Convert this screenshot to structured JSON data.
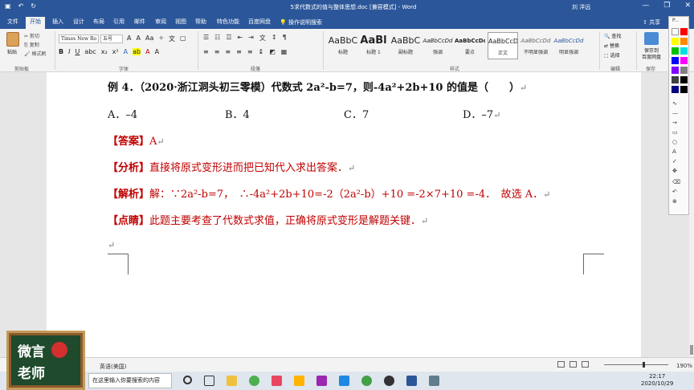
{
  "titlebar": {
    "title": "5求代数式的值与整体思想.doc [兼容模式] - Word",
    "user": "刘 洋远",
    "controls": [
      "—",
      "❐",
      "✕"
    ]
  },
  "tabs": [
    {
      "label": "文件"
    },
    {
      "label": "开始"
    },
    {
      "label": "插入"
    },
    {
      "label": "设计"
    },
    {
      "label": "布局"
    },
    {
      "label": "引用"
    },
    {
      "label": "邮件"
    },
    {
      "label": "审阅"
    },
    {
      "label": "视图"
    },
    {
      "label": "帮助"
    },
    {
      "label": "特色功能"
    },
    {
      "label": "百度网盘"
    }
  ],
  "tell_me": "操作说明搜索",
  "share": "共享",
  "ribbon": {
    "clipboard": {
      "paste": "粘贴",
      "cut": "剪切",
      "copy": "复制",
      "format_painter": "格式刷",
      "label": "剪贴板"
    },
    "font": {
      "name": "Times New Ro",
      "size": "五号",
      "label": "字体"
    },
    "paragraph": {
      "label": "段落"
    },
    "styles": {
      "items": [
        {
          "sample": "AaBbC",
          "name": "标题"
        },
        {
          "sample": "AaBl",
          "name": "标题 1"
        },
        {
          "sample": "AaBbC",
          "name": "副标题"
        },
        {
          "sample": "AaBbCcDd",
          "name": "强调"
        },
        {
          "sample": "AaBbCcDc",
          "name": "要点"
        },
        {
          "sample": "AaBbCcD",
          "name": "正文"
        },
        {
          "sample": "AaBbCcDd",
          "name": "不明显强调"
        },
        {
          "sample": "AaBbCcDd",
          "name": "明显强调"
        }
      ],
      "label": "样式"
    },
    "editing": {
      "find": "查找",
      "replace": "替换",
      "select": "选择",
      "label": "编辑"
    },
    "save": {
      "line1": "保存到",
      "line2": "百度网盘",
      "label": "保存"
    }
  },
  "doc": {
    "example": "例 4．（2020·浙江洞头初三零模）代数式 2a²-b=7，则-4a²+2b+10 的值是（　　）",
    "options": [
      "A．–4",
      "B．4",
      "C．7",
      "D．–7"
    ],
    "answer": {
      "tag": "【答案】",
      "text": "A"
    },
    "analysis": {
      "tag": "【分析】",
      "text": "直接将原式变形进而把已知代入求出答案．"
    },
    "solution": {
      "tag": "【解析】",
      "text": "解：∵2a²-b=7，　∴-4a²+2b+10=-2（2a²-b）+10 =-2×7+10 =-4．　故选 A．"
    },
    "comment": {
      "tag": "【点睛】",
      "text": "此题主要考查了代数式求值，正确将原式变形是解题关键．"
    },
    "return_mark": "↵"
  },
  "status": {
    "language": "英语(美国)",
    "zoom": "190%"
  },
  "taskbar": {
    "search_placeholder": "在这里输入你要搜索的内容",
    "time": "22:17",
    "date": "2020/10/29"
  },
  "logo": {
    "line1": "微言",
    "line2": "老师"
  },
  "palette": {
    "label": "P..."
  }
}
